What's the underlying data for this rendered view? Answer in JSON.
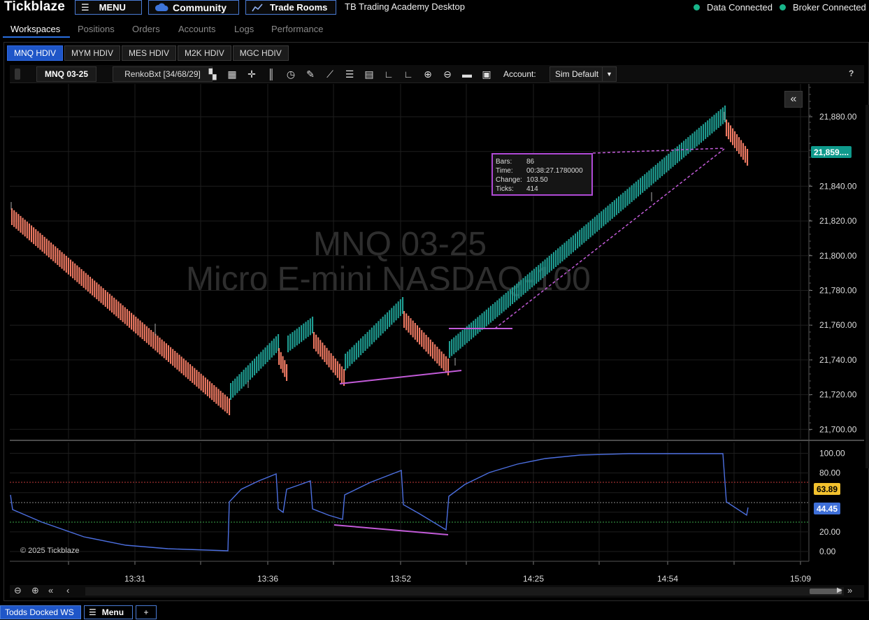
{
  "topbar": {
    "brand": "Tickblaze",
    "menu_label": "MENU",
    "community_label": "Community",
    "trade_rooms_label": "Trade Rooms",
    "app_title": "TB Trading Academy Desktop",
    "data_status": "Data Connected",
    "broker_status": "Broker Connected",
    "status_color": "#18b58a"
  },
  "nav": {
    "tabs": [
      "Workspaces",
      "Positions",
      "Orders",
      "Accounts",
      "Logs",
      "Performance"
    ],
    "active": "Workspaces"
  },
  "chart_tabs": [
    "MNQ HDIV",
    "MYM HDIV",
    "MES HDIV",
    "M2K HDIV",
    "MGC HDIV"
  ],
  "toolbar": {
    "symbol": "MNQ 03-25",
    "bar_type": "RenkoBxt [34/68/29]",
    "account_label": "Account:",
    "account_value": "Sim Default",
    "help": "?",
    "icons": [
      "chart-style-icon",
      "bar-type-icon",
      "crosshair-icon",
      "bars-icon",
      "clock-icon",
      "draw-pencil-icon",
      "line-tool-icon",
      "list-icon",
      "data-box-icon",
      "axis-icon",
      "axis-alt-icon",
      "zoom-in-icon",
      "zoom-out-icon",
      "folder-icon",
      "save-icon"
    ]
  },
  "watermark": {
    "line1": "MNQ 03-25",
    "line2": "Micro E-mini NASDAQ-100"
  },
  "tooltip": {
    "rows": [
      {
        "k": "Bars:",
        "v": "86"
      },
      {
        "k": "Time:",
        "v": "00:38:27.1780000"
      },
      {
        "k": "Change:",
        "v": "103.50"
      },
      {
        "k": "Ticks:",
        "v": "414"
      }
    ]
  },
  "price_axis": {
    "labels": [
      "21,880.00",
      "21,840.00",
      "21,820.00",
      "21,800.00",
      "21,780.00",
      "21,760.00",
      "21,740.00",
      "21,720.00",
      "21,700.00"
    ],
    "current": "21,859...."
  },
  "osc_axis": {
    "labels": [
      "100.00",
      "80.00",
      "20.00",
      "0.00"
    ],
    "badge_upper": "63.89",
    "badge_lower": "44.45"
  },
  "time_axis": [
    "13:31",
    "13:36",
    "13:52",
    "14:25",
    "14:54",
    "15:09"
  ],
  "copyright": "© 2025 Tickblaze",
  "footer": {
    "workspace": "Todds Docked WS",
    "menu": "Menu",
    "add": "+"
  },
  "colors": {
    "up_bar": "#1f9e93",
    "down_bar": "#f07a63",
    "accent": "#1f56c8",
    "annotation": "#c25bd8",
    "oscillator": "#4c6fe0",
    "badge_teal": "#0f9a8c",
    "badge_yellow": "#f2c12e",
    "badge_blue": "#3e6fd8"
  }
}
